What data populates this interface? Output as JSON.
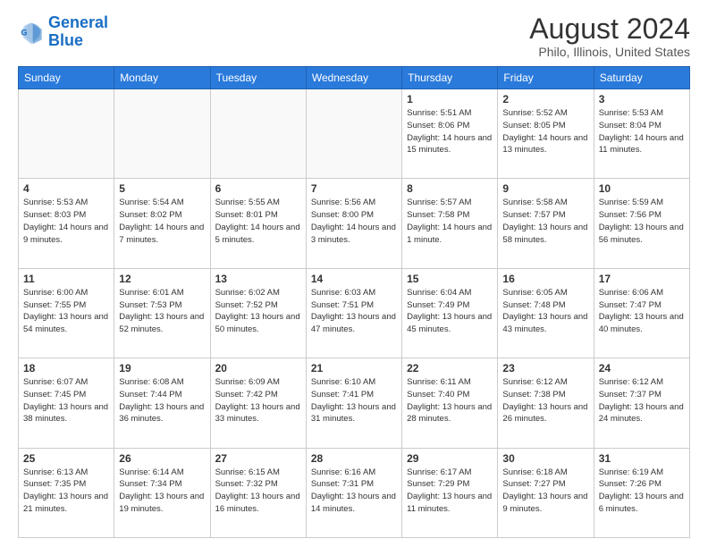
{
  "logo": {
    "line1": "General",
    "line2": "Blue"
  },
  "title": "August 2024",
  "subtitle": "Philo, Illinois, United States",
  "days_of_week": [
    "Sunday",
    "Monday",
    "Tuesday",
    "Wednesday",
    "Thursday",
    "Friday",
    "Saturday"
  ],
  "weeks": [
    [
      {
        "day": "",
        "info": "",
        "empty": true
      },
      {
        "day": "",
        "info": "",
        "empty": true
      },
      {
        "day": "",
        "info": "",
        "empty": true
      },
      {
        "day": "",
        "info": "",
        "empty": true
      },
      {
        "day": "1",
        "info": "Sunrise: 5:51 AM\nSunset: 8:06 PM\nDaylight: 14 hours\nand 15 minutes."
      },
      {
        "day": "2",
        "info": "Sunrise: 5:52 AM\nSunset: 8:05 PM\nDaylight: 14 hours\nand 13 minutes."
      },
      {
        "day": "3",
        "info": "Sunrise: 5:53 AM\nSunset: 8:04 PM\nDaylight: 14 hours\nand 11 minutes."
      }
    ],
    [
      {
        "day": "4",
        "info": "Sunrise: 5:53 AM\nSunset: 8:03 PM\nDaylight: 14 hours\nand 9 minutes."
      },
      {
        "day": "5",
        "info": "Sunrise: 5:54 AM\nSunset: 8:02 PM\nDaylight: 14 hours\nand 7 minutes."
      },
      {
        "day": "6",
        "info": "Sunrise: 5:55 AM\nSunset: 8:01 PM\nDaylight: 14 hours\nand 5 minutes."
      },
      {
        "day": "7",
        "info": "Sunrise: 5:56 AM\nSunset: 8:00 PM\nDaylight: 14 hours\nand 3 minutes."
      },
      {
        "day": "8",
        "info": "Sunrise: 5:57 AM\nSunset: 7:58 PM\nDaylight: 14 hours\nand 1 minute."
      },
      {
        "day": "9",
        "info": "Sunrise: 5:58 AM\nSunset: 7:57 PM\nDaylight: 13 hours\nand 58 minutes."
      },
      {
        "day": "10",
        "info": "Sunrise: 5:59 AM\nSunset: 7:56 PM\nDaylight: 13 hours\nand 56 minutes."
      }
    ],
    [
      {
        "day": "11",
        "info": "Sunrise: 6:00 AM\nSunset: 7:55 PM\nDaylight: 13 hours\nand 54 minutes."
      },
      {
        "day": "12",
        "info": "Sunrise: 6:01 AM\nSunset: 7:53 PM\nDaylight: 13 hours\nand 52 minutes."
      },
      {
        "day": "13",
        "info": "Sunrise: 6:02 AM\nSunset: 7:52 PM\nDaylight: 13 hours\nand 50 minutes."
      },
      {
        "day": "14",
        "info": "Sunrise: 6:03 AM\nSunset: 7:51 PM\nDaylight: 13 hours\nand 47 minutes."
      },
      {
        "day": "15",
        "info": "Sunrise: 6:04 AM\nSunset: 7:49 PM\nDaylight: 13 hours\nand 45 minutes."
      },
      {
        "day": "16",
        "info": "Sunrise: 6:05 AM\nSunset: 7:48 PM\nDaylight: 13 hours\nand 43 minutes."
      },
      {
        "day": "17",
        "info": "Sunrise: 6:06 AM\nSunset: 7:47 PM\nDaylight: 13 hours\nand 40 minutes."
      }
    ],
    [
      {
        "day": "18",
        "info": "Sunrise: 6:07 AM\nSunset: 7:45 PM\nDaylight: 13 hours\nand 38 minutes."
      },
      {
        "day": "19",
        "info": "Sunrise: 6:08 AM\nSunset: 7:44 PM\nDaylight: 13 hours\nand 36 minutes."
      },
      {
        "day": "20",
        "info": "Sunrise: 6:09 AM\nSunset: 7:42 PM\nDaylight: 13 hours\nand 33 minutes."
      },
      {
        "day": "21",
        "info": "Sunrise: 6:10 AM\nSunset: 7:41 PM\nDaylight: 13 hours\nand 31 minutes."
      },
      {
        "day": "22",
        "info": "Sunrise: 6:11 AM\nSunset: 7:40 PM\nDaylight: 13 hours\nand 28 minutes."
      },
      {
        "day": "23",
        "info": "Sunrise: 6:12 AM\nSunset: 7:38 PM\nDaylight: 13 hours\nand 26 minutes."
      },
      {
        "day": "24",
        "info": "Sunrise: 6:12 AM\nSunset: 7:37 PM\nDaylight: 13 hours\nand 24 minutes."
      }
    ],
    [
      {
        "day": "25",
        "info": "Sunrise: 6:13 AM\nSunset: 7:35 PM\nDaylight: 13 hours\nand 21 minutes."
      },
      {
        "day": "26",
        "info": "Sunrise: 6:14 AM\nSunset: 7:34 PM\nDaylight: 13 hours\nand 19 minutes."
      },
      {
        "day": "27",
        "info": "Sunrise: 6:15 AM\nSunset: 7:32 PM\nDaylight: 13 hours\nand 16 minutes."
      },
      {
        "day": "28",
        "info": "Sunrise: 6:16 AM\nSunset: 7:31 PM\nDaylight: 13 hours\nand 14 minutes."
      },
      {
        "day": "29",
        "info": "Sunrise: 6:17 AM\nSunset: 7:29 PM\nDaylight: 13 hours\nand 11 minutes."
      },
      {
        "day": "30",
        "info": "Sunrise: 6:18 AM\nSunset: 7:27 PM\nDaylight: 13 hours\nand 9 minutes."
      },
      {
        "day": "31",
        "info": "Sunrise: 6:19 AM\nSunset: 7:26 PM\nDaylight: 13 hours\nand 6 minutes."
      }
    ]
  ]
}
